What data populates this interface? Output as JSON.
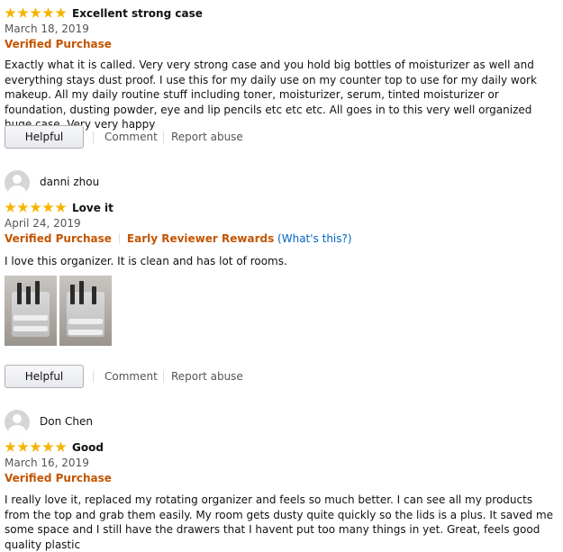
{
  "reviews": [
    {
      "profile_name": "",
      "stars": 5,
      "title": "Excellent strong case",
      "date": "March 18, 2019",
      "verified_label": "Verified Purchase",
      "body": "Exactly what it is called. Very very strong case and you hold big bottles of moisturizer as well and everything stays dust proof. I use this for my daily use on my counter top to use for my daily work makeup. All my daily routine stuff including toner, moisturizer, serum, tinted moisturizer or foundation, dusting powder, eye and lip pencils etc etc etc. All goes in to this very well organized huge case. Very very happy"
    },
    {
      "profile_name": "danni zhou",
      "stars": 5,
      "title": "Love it",
      "date": "April 24, 2019",
      "verified_label": "Verified Purchase",
      "early_reviewer_label": "Early Reviewer Rewards",
      "whats_this_label": "(What's this?)",
      "body": "I love this organizer. It is clean and has lot of rooms.",
      "images": [
        "organizer-photo-1",
        "organizer-photo-2"
      ]
    },
    {
      "profile_name": "Don Chen",
      "stars": 5,
      "title": "Good",
      "date": "March 16, 2019",
      "verified_label": "Verified Purchase",
      "body": "I really love it, replaced my rotating organizer and feels so much better. I can see all my products from the top and grab them easily. My room gets dusty quite quickly so the lids is a plus. It saved me some space and I still have the drawers that I havent put too many things in yet. Great, feels good quality plastic"
    }
  ],
  "actions": {
    "helpful_label": "Helpful",
    "comment_label": "Comment",
    "report_label": "Report abuse"
  },
  "colors": {
    "star": "#f4b400",
    "verified": "#c45500",
    "link": "#0066c0",
    "muted": "#555555"
  }
}
